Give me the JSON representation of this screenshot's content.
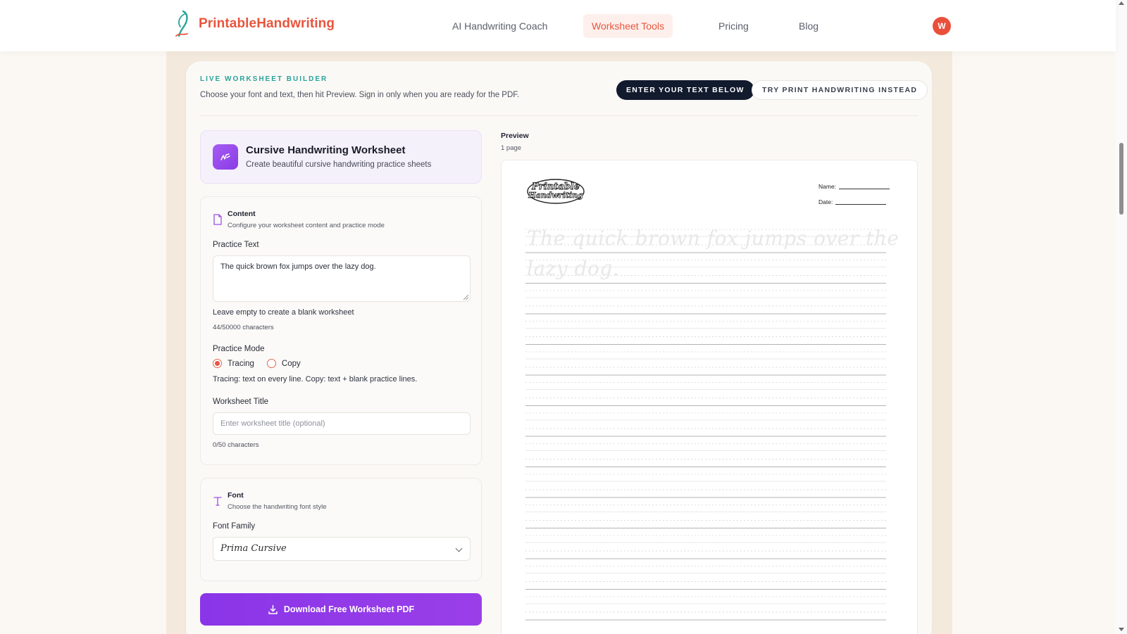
{
  "header": {
    "brand": "PrintableHandwriting",
    "nav": [
      "AI Handwriting Coach",
      "Worksheet Tools",
      "Pricing",
      "Blog"
    ],
    "active_nav": "Worksheet Tools",
    "avatar_initial": "W"
  },
  "builder": {
    "eyebrow": "LIVE WORKSHEET BUILDER",
    "subtitle": "Choose your font and text, then hit Preview. Sign in only when you are ready for the PDF.",
    "enter_text_button": "ENTER YOUR TEXT BELOW",
    "print_button": "TRY PRINT HANDWRITING INSTEAD"
  },
  "worksheet": {
    "title": "Cursive Handwriting Worksheet",
    "subtitle": "Create beautiful cursive handwriting practice sheets"
  },
  "content": {
    "section_title": "Content",
    "section_sub": "Configure your worksheet content and practice mode",
    "practice_label": "Practice Text",
    "practice_value": "The quick brown fox jumps over the lazy dog.",
    "blank_hint": "Leave empty to create a blank worksheet",
    "char_count": "44/50000 characters",
    "mode_label": "Practice Mode",
    "mode_tracing": "Tracing",
    "mode_copy": "Copy",
    "mode_selected": "Tracing",
    "mode_hint": "Tracing: text on every line. Copy: text + blank practice lines.",
    "title_label": "Worksheet Title",
    "title_placeholder": "Enter worksheet title (optional)",
    "title_count": "0/50 characters"
  },
  "font": {
    "section_title": "Font",
    "section_sub": "Choose the handwriting font style",
    "family_label": "Font Family",
    "family_value": "Prima Cursive"
  },
  "download_label": "Download Free Worksheet PDF",
  "preview": {
    "label": "Preview",
    "pages": "1 page",
    "name_label": "Name:",
    "date_label": "Date:",
    "logo_text": "Printable Handwriting",
    "line1": "The quick brown fox jumps over the",
    "line2": "lazy dog."
  }
}
